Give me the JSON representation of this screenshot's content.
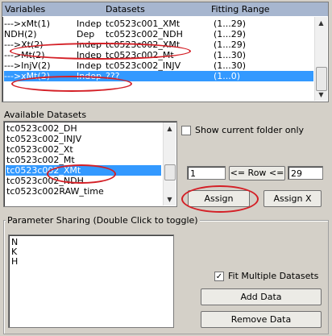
{
  "headers": {
    "variables": "Variables",
    "datasets": "Datasets",
    "fitting_range": "Fitting Range"
  },
  "fit_rows": [
    {
      "var": "--->xMt(1)",
      "kind": "Indep",
      "dataset": "tc0523c001_XMt",
      "range": "(1...29)"
    },
    {
      "var": "NDH(2)",
      "kind": "Dep",
      "dataset": "tc0523c002_NDH",
      "range": "(1...29)"
    },
    {
      "var": "--->Xt(2)",
      "kind": "Indep",
      "dataset": "tc0523c002_XMt",
      "range": "(1...29)"
    },
    {
      "var": "--->Mt(2)",
      "kind": "Indep",
      "dataset": "tc0523c002_Mt",
      "range": "(1...30)"
    },
    {
      "var": "--->InjV(2)",
      "kind": "Indep",
      "dataset": "tc0523c002_INJV",
      "range": "(1...30)"
    },
    {
      "var": "--->xMt(2)",
      "kind": "Indep",
      "dataset": "???",
      "range": "(1...0)"
    }
  ],
  "available": {
    "label": "Available Datasets",
    "items": [
      "tc0523c002_DH",
      "tc0523c002_INJV",
      "tc0523c002_Xt",
      "tc0523c002_Mt",
      "tc0523c002_XMt",
      "tc0523c002_NDH",
      "tc0523c002RAW_time"
    ],
    "show_current_folder_only": "Show current folder only"
  },
  "row_range": {
    "from": "1",
    "button": "<= Row <=",
    "to": "29"
  },
  "buttons": {
    "assign": "Assign",
    "assign_x": "Assign X",
    "add_data": "Add Data",
    "remove_data": "Remove Data"
  },
  "sharing": {
    "label": "Parameter Sharing (Double Click to toggle)",
    "params": [
      "N",
      "K",
      "H"
    ],
    "fit_multiple": "Fit Multiple Datasets"
  }
}
